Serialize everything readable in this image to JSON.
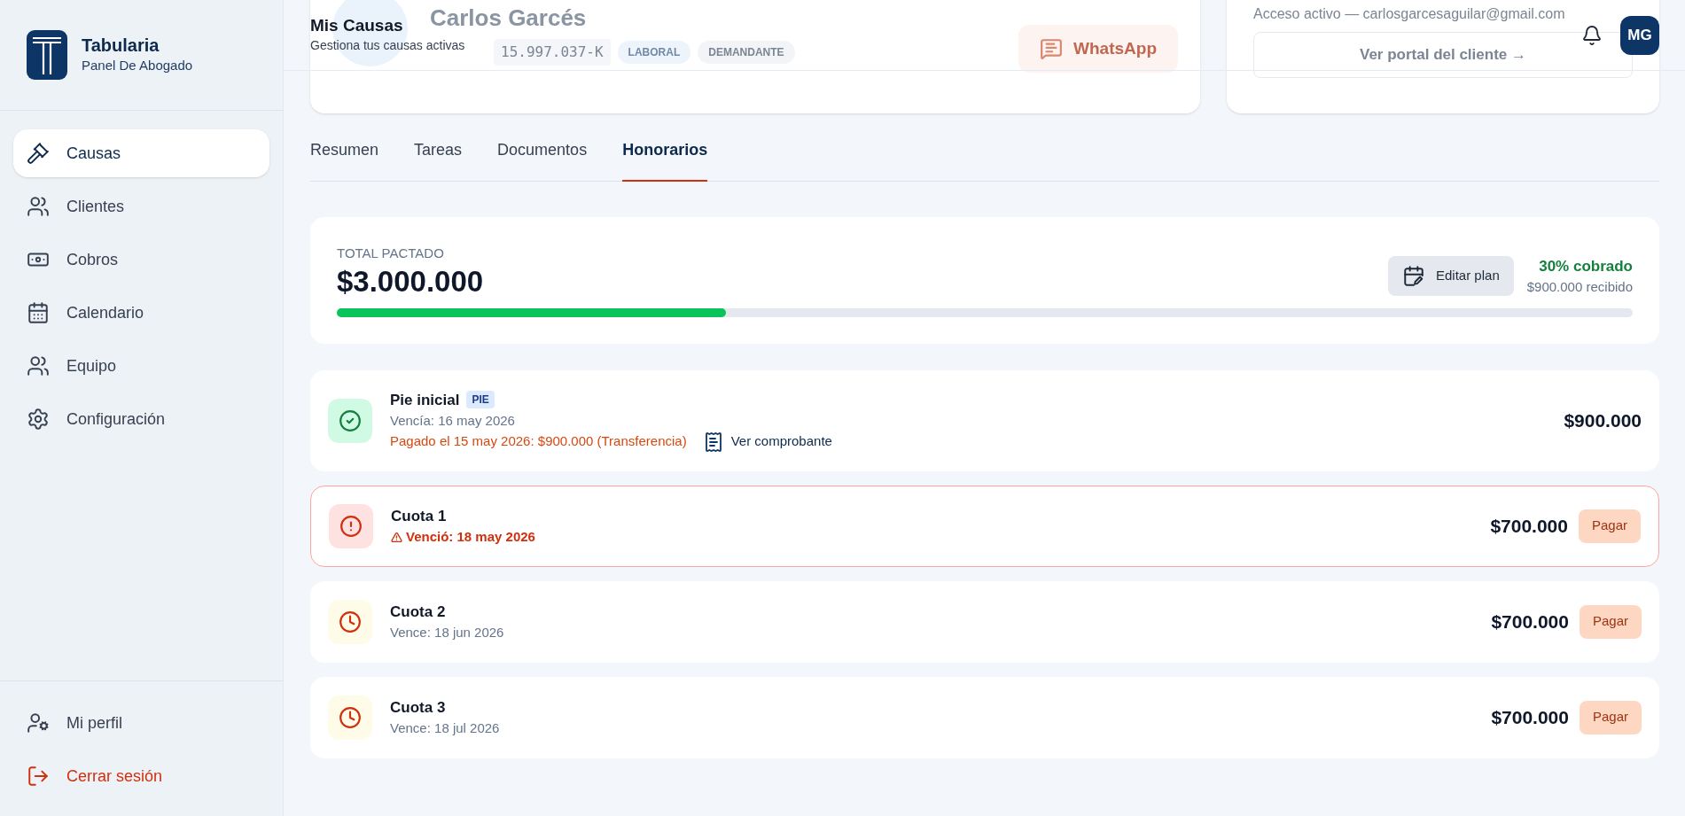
{
  "header": {
    "title": "Mis Causas",
    "subtitle": "Gestiona tus causas activas",
    "avatar": "MG"
  },
  "sidebar": {
    "brand": "Tabularia",
    "tagline": "Panel De Abogado",
    "items": [
      {
        "label": "Causas",
        "selected": true
      },
      {
        "label": "Clientes",
        "selected": false
      },
      {
        "label": "Cobros",
        "selected": false
      },
      {
        "label": "Calendario",
        "selected": false
      },
      {
        "label": "Equipo",
        "selected": false
      },
      {
        "label": "Configuración",
        "selected": false
      }
    ],
    "footer": [
      {
        "kind": "profile",
        "label": "Mi perfil"
      },
      {
        "kind": "logout",
        "label": "Cerrar sesión"
      }
    ]
  },
  "client_card": {
    "name": "Carlos Garcés",
    "rut": "15.997.037-K",
    "tags": [
      "LABORAL",
      "DEMANDANTE"
    ],
    "whatsapp": "WhatsApp"
  },
  "access_card": {
    "text": "Acceso activo — carlosgarcesaguilar@gmail.com",
    "button": "Ver portal del cliente →"
  },
  "tabs": [
    {
      "label": "Resumen",
      "selected": false
    },
    {
      "label": "Tareas",
      "selected": false
    },
    {
      "label": "Documentos",
      "selected": false
    },
    {
      "label": "Honorarios",
      "selected": true
    }
  ],
  "total": {
    "label": "TOTAL PACTADO",
    "amount": "$3.000.000",
    "button": "Editar plan",
    "percent": "30% cobrado",
    "received": "$900.000 recibido",
    "level": 0.3
  },
  "installments": [
    {
      "kind": "paid",
      "title": "Pie inicial",
      "badge": "PIE",
      "due": "Vencía: 16 may 2026",
      "payment": "Pagado el 15 may 2026: $900.000 (Transferencia)",
      "receipt": "Ver comprobante",
      "amount": "$900.000"
    },
    {
      "kind": "overdue",
      "title": "Cuota 1",
      "due": "Venció: 18 may 2026",
      "amount": "$700.000",
      "action": "Pagar"
    },
    {
      "kind": "pending",
      "title": "Cuota 2",
      "due": "Vence: 18 jun 2026",
      "amount": "$700.000",
      "action": "Pagar"
    },
    {
      "kind": "pending",
      "title": "Cuota 3",
      "due": "Vence: 18 jul 2026",
      "amount": "$700.000",
      "action": "Pagar"
    }
  ]
}
